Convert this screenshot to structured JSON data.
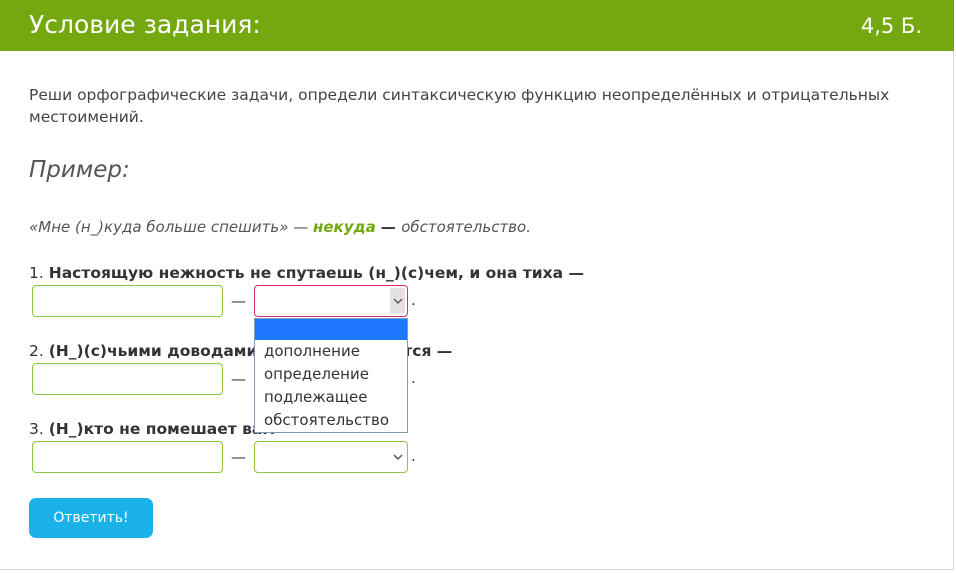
{
  "header": {
    "title": "Условие задания:",
    "points": "4,5 Б.",
    "accent_color": "#73a80e"
  },
  "instructions": "Реши орфографические задачи, определи синтаксическую функцию неопределённых и отрицательных местоимений.",
  "example": {
    "heading": "Пример:",
    "sentence": "«Мне (н_)куда больше спешить» — ",
    "answer_word": "некуда",
    "dash": " — ",
    "function": "обстоятельство."
  },
  "questions": [
    {
      "number": "1. ",
      "text": "Настоящую нежность не спутаешь (н_)(с)чем, и она тиха —",
      "input_value": "",
      "dash": "—",
      "select_value": "",
      "period": "."
    },
    {
      "number": "2. ",
      "text": "(Н_)(с)чьими доводами он не соглашается —",
      "input_value": "",
      "dash": "—",
      "select_value": "",
      "period": "."
    },
    {
      "number": "3. ",
      "text": "(Н_)кто не помешает вам —",
      "input_value": "",
      "dash": "—",
      "select_value": "",
      "period": "."
    }
  ],
  "dropdown": {
    "options": [
      "",
      "дополнение",
      "определение",
      "подлежащее",
      "обстоятельство"
    ],
    "selected_color": "#1e78ff"
  },
  "submit_label": "Ответить!",
  "submit_color": "#1ab2e8"
}
